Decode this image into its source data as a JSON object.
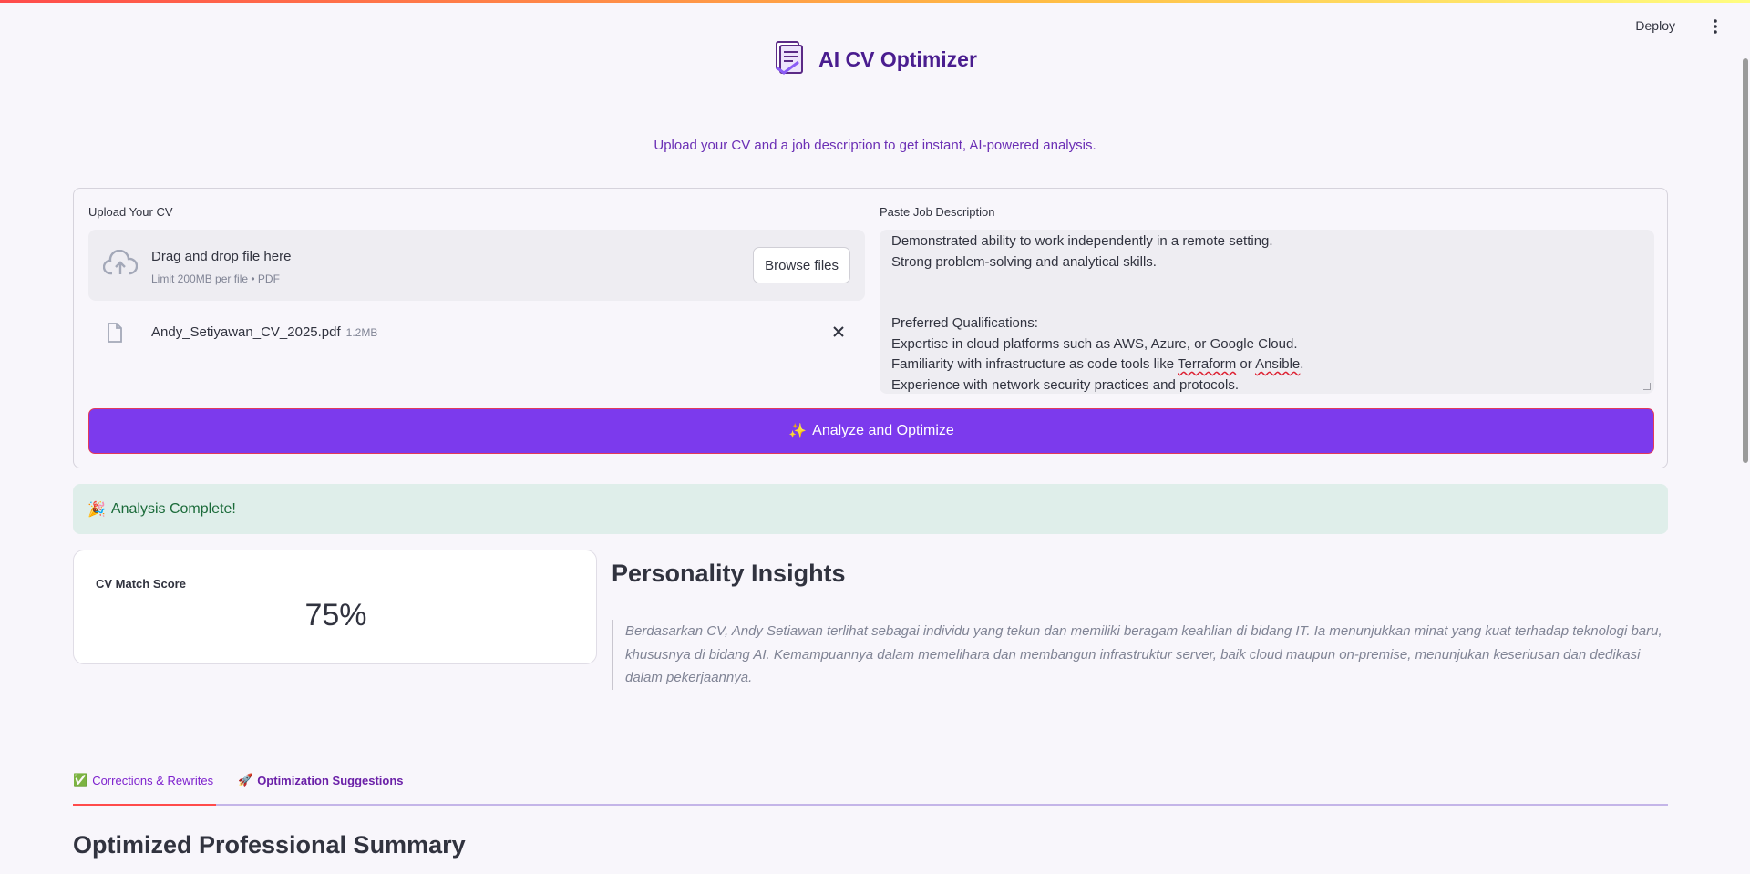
{
  "header": {
    "deploy_label": "Deploy",
    "menu_icon": "more-vertical-icon"
  },
  "app": {
    "logo_icon": "document-check-icon",
    "title": "AI CV Optimizer",
    "subtitle": "Upload your CV and a job description to get instant, AI-powered analysis."
  },
  "upload": {
    "label": "Upload Your CV",
    "dropzone_title": "Drag and drop file here",
    "dropzone_limit": "Limit 200MB per file • PDF",
    "browse_label": "Browse files",
    "file_name": "Andy_Setiyawan_CV_2025.pdf",
    "file_size": "1.2MB"
  },
  "job_description": {
    "label": "Paste Job Description",
    "lines": [
      "Demonstrated ability to work independently in a remote setting.",
      "Strong problem-solving and analytical skills.",
      "",
      "",
      "Preferred Qualifications:",
      "Expertise in cloud platforms such as AWS, Azure, or Google Cloud.",
      "Familiarity with infrastructure as code tools like Terraform or Ansible.",
      "Experience with network security practices and protocols."
    ]
  },
  "analyze_button": {
    "emoji": "✨",
    "label": "Analyze and Optimize"
  },
  "status": {
    "emoji": "🎉",
    "message": "Analysis Complete!"
  },
  "metric": {
    "label": "CV Match Score",
    "value": "75%"
  },
  "insights": {
    "title": "Personality Insights",
    "text": "Berdasarkan CV, Andy Setiawan terlihat sebagai individu yang tekun dan memiliki beragam keahlian di bidang IT. Ia menunjukkan minat yang kuat terhadap teknologi baru, khususnya di bidang AI. Kemampuannya dalam memelihara dan membangun infrastruktur server, baik cloud maupun on-premise, menunjukan keseriusan dan dedikasi dalam pekerjaannya."
  },
  "tabs": [
    {
      "emoji": "✅",
      "label": "Corrections & Rewrites",
      "active": true
    },
    {
      "emoji": "🚀",
      "label": "Optimization Suggestions",
      "active": false
    }
  ],
  "section": {
    "title": "Optimized Professional Summary"
  },
  "colors": {
    "accent": "#7c3aed",
    "title": "#4a1d8f",
    "success_bg": "#dfeeea",
    "tab_underline": "#ff4b4b"
  }
}
